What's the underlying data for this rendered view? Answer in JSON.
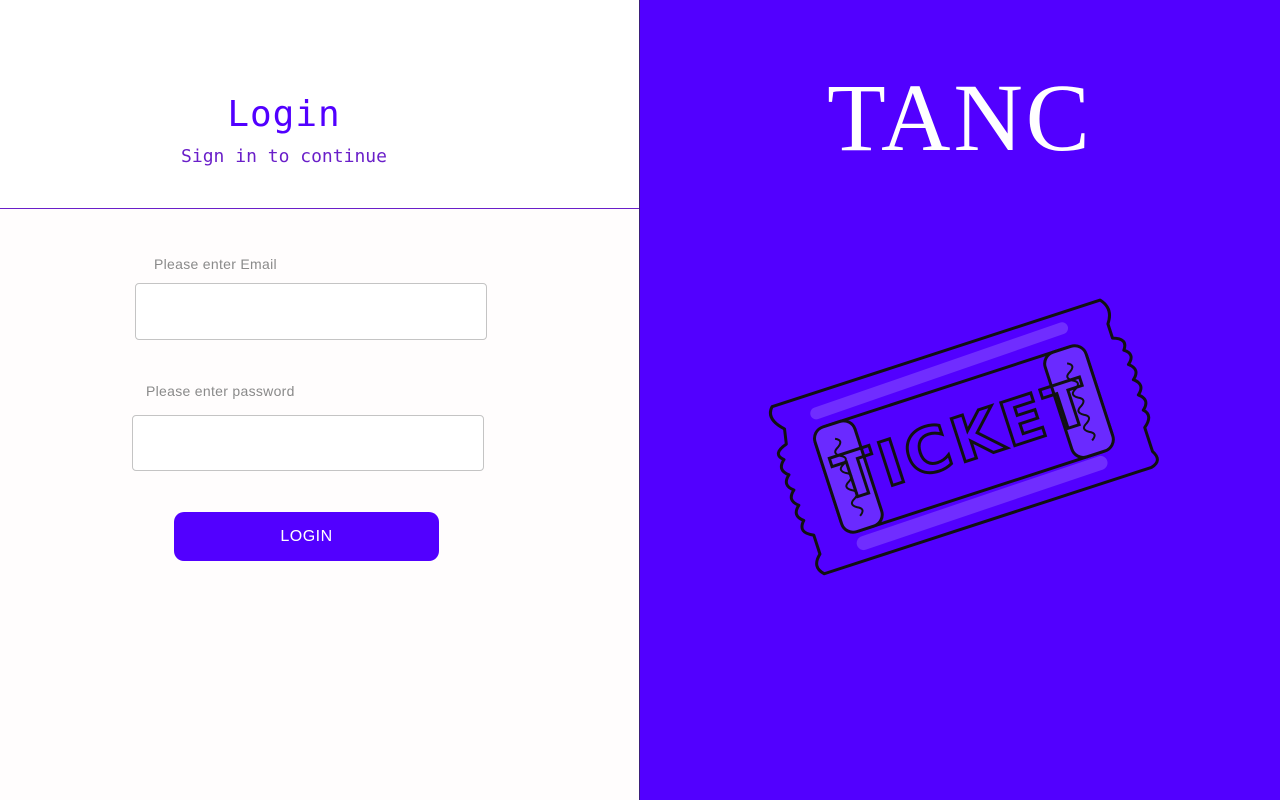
{
  "login": {
    "title": "Login",
    "subtitle": "Sign in to continue",
    "email_label": "Please enter Email",
    "email_value": "",
    "password_label": "Please enter password",
    "password_value": "",
    "button_label": "LOGIN"
  },
  "brand": {
    "title": "TANC",
    "illustration": "ticket-illustration",
    "illustration_text": "TICKET"
  },
  "colors": {
    "accent": "#5200ff",
    "subtitle": "#6a1fc9",
    "label": "#8a8a8a",
    "brand_text": "#ffffff"
  }
}
